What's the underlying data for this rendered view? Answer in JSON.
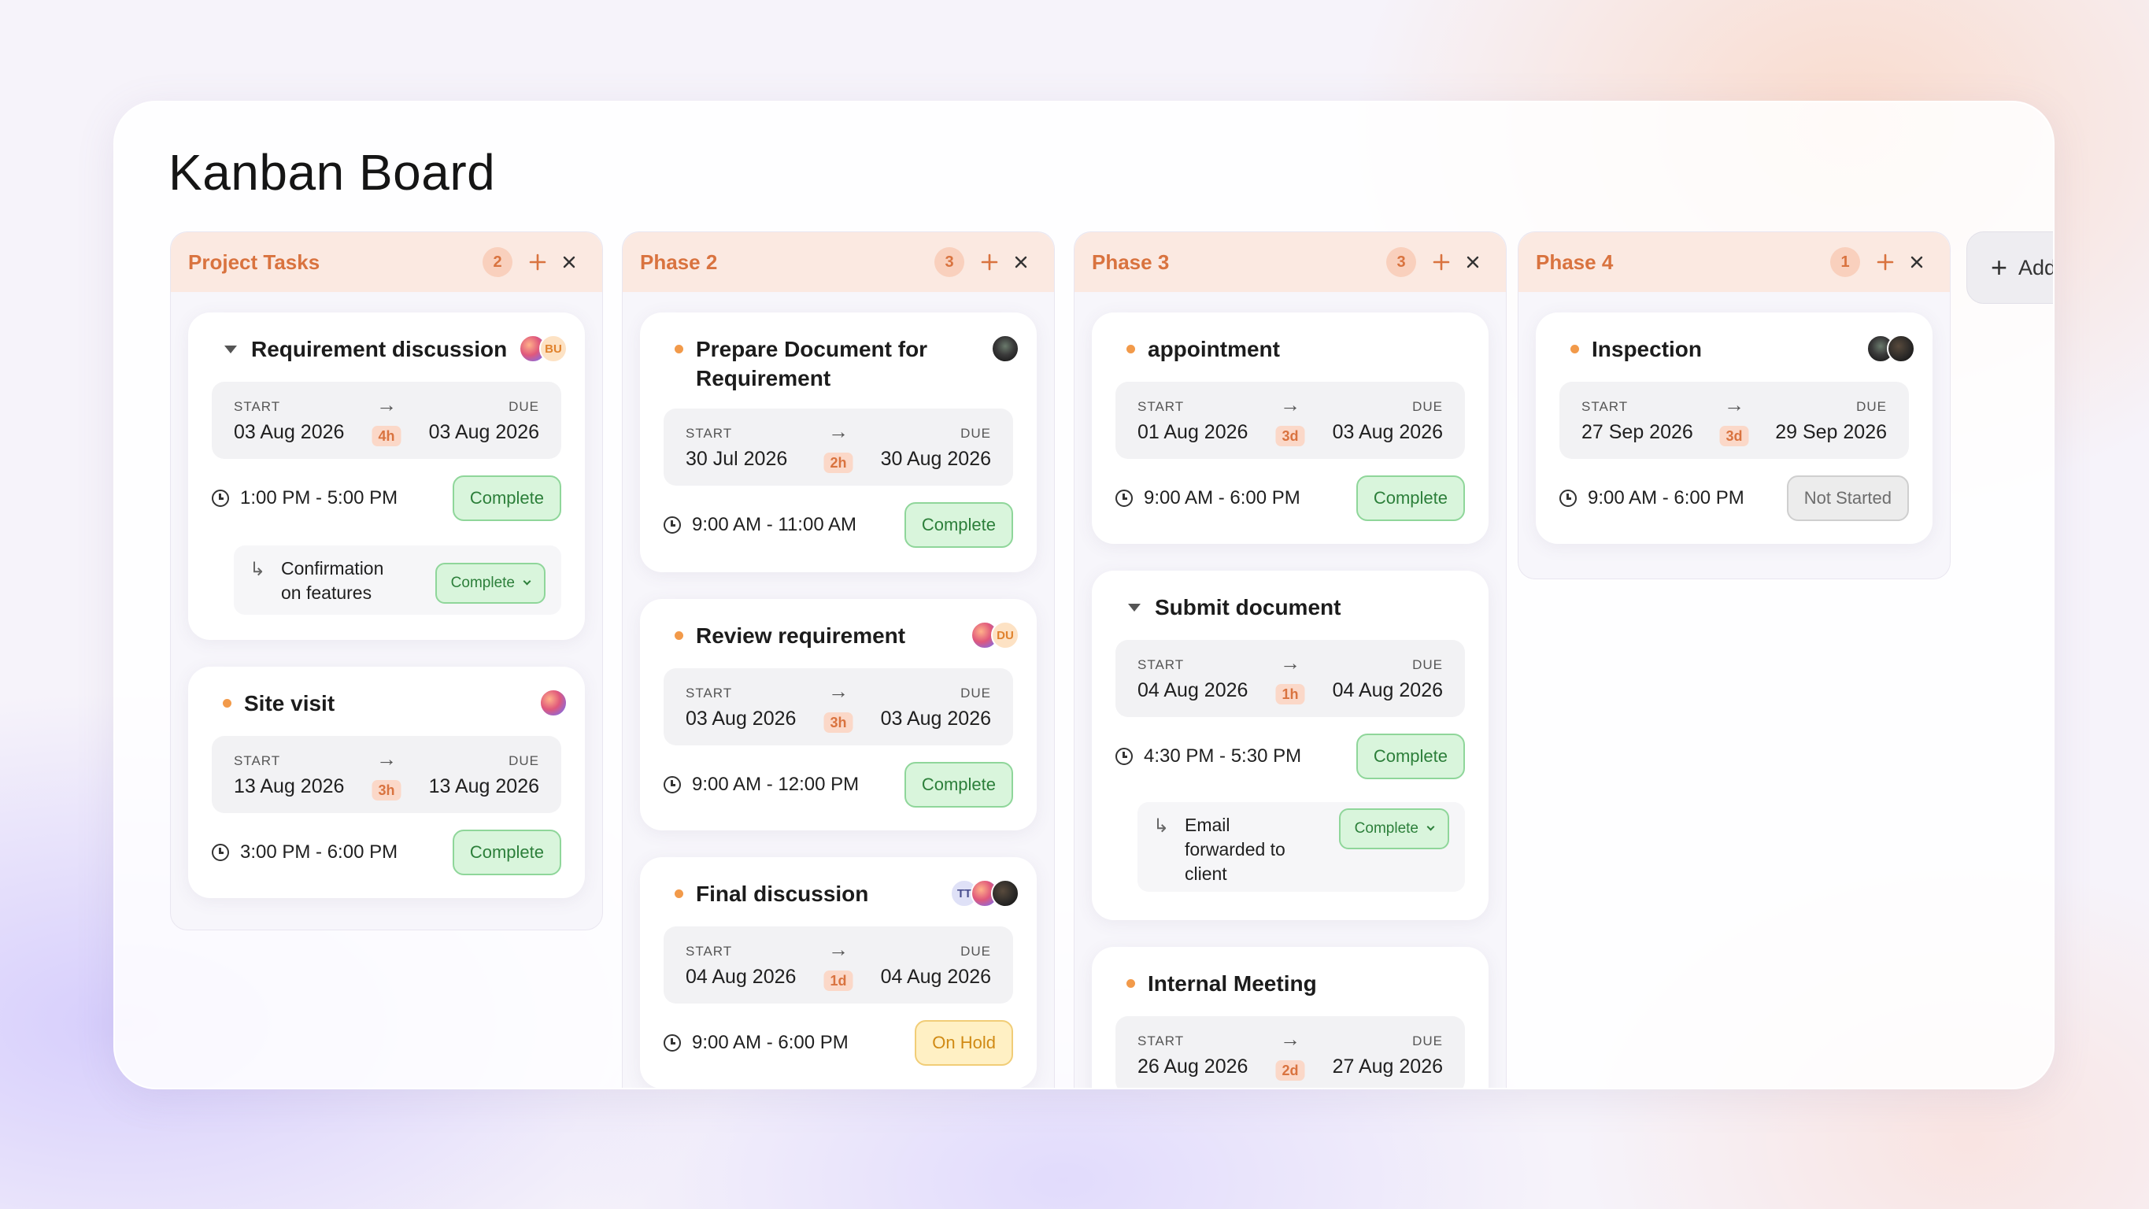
{
  "board": {
    "title": "Kanban Board",
    "add_column_label": "Add"
  },
  "labels": {
    "start": "START",
    "due": "DUE",
    "arrow": "→",
    "subtask_arrow": "↳"
  },
  "colors": {
    "accent": "#d9733f",
    "header_bg": "#fbe9e1",
    "complete": "#2c7f3a",
    "on_hold": "#d08a14",
    "not_started": "#6d6d6d"
  },
  "columns": [
    {
      "title": "Project Tasks",
      "count": "2",
      "cards": [
        {
          "title": "Requirement discussion",
          "expanded": true,
          "avatars": [
            "image-avatar",
            "BU"
          ],
          "start": "03 Aug 2026",
          "duration": "4h",
          "due": "03 Aug 2026",
          "time": "1:00 PM - 5:00 PM",
          "status": "Complete",
          "subtask": {
            "text_lines": [
              "Confirmation",
              "on features"
            ],
            "status": "Complete"
          }
        },
        {
          "title": "Site visit",
          "avatars": [
            "image-avatar"
          ],
          "start": "13 Aug 2026",
          "duration": "3h",
          "due": "13 Aug 2026",
          "time": "3:00 PM - 6:00 PM",
          "status": "Complete"
        }
      ]
    },
    {
      "title": "Phase 2",
      "count": "3",
      "cards": [
        {
          "title_lines": [
            "Prepare Document for",
            "Requirement"
          ],
          "avatars": [
            "photo-avatar"
          ],
          "start": "30 Jul 2026",
          "duration": "2h",
          "due": "30 Aug 2026",
          "time": "9:00 AM - 11:00 AM",
          "status": "Complete"
        },
        {
          "title": "Review requirement",
          "avatars": [
            "image-avatar",
            "DU"
          ],
          "start": "03 Aug 2026",
          "duration": "3h",
          "due": "03 Aug 2026",
          "time": "9:00 AM - 12:00 PM",
          "status": "Complete"
        },
        {
          "title": "Final discussion",
          "avatars": [
            "TT",
            "image-avatar",
            "photo-avatar"
          ],
          "start": "04 Aug 2026",
          "duration": "1d",
          "due": "04 Aug 2026",
          "time": "9:00 AM - 6:00 PM",
          "status": "On Hold"
        }
      ]
    },
    {
      "title": "Phase 3",
      "count": "3",
      "cards": [
        {
          "title": "appointment",
          "start": "01 Aug 2026",
          "duration": "3d",
          "due": "03 Aug 2026",
          "time": "9:00 AM - 6:00 PM",
          "status": "Complete"
        },
        {
          "title": "Submit document",
          "expanded": true,
          "start": "04 Aug 2026",
          "duration": "1h",
          "due": "04 Aug 2026",
          "time": "4:30 PM - 5:30 PM",
          "status": "Complete",
          "subtask": {
            "text_lines": [
              "Email",
              "forwarded to",
              "client"
            ],
            "status": "Complete"
          }
        },
        {
          "title": "Internal Meeting",
          "start": "26 Aug 2026",
          "duration": "2d",
          "due": "27 Aug 2026"
        }
      ]
    },
    {
      "title": "Phase 4",
      "count": "1",
      "cards": [
        {
          "title": "Inspection",
          "avatars": [
            "photo-avatar",
            "photo-avatar"
          ],
          "start": "27 Sep 2026",
          "duration": "3d",
          "due": "29 Sep 2026",
          "time": "9:00 AM - 6:00 PM",
          "status": "Not Started"
        }
      ]
    }
  ]
}
